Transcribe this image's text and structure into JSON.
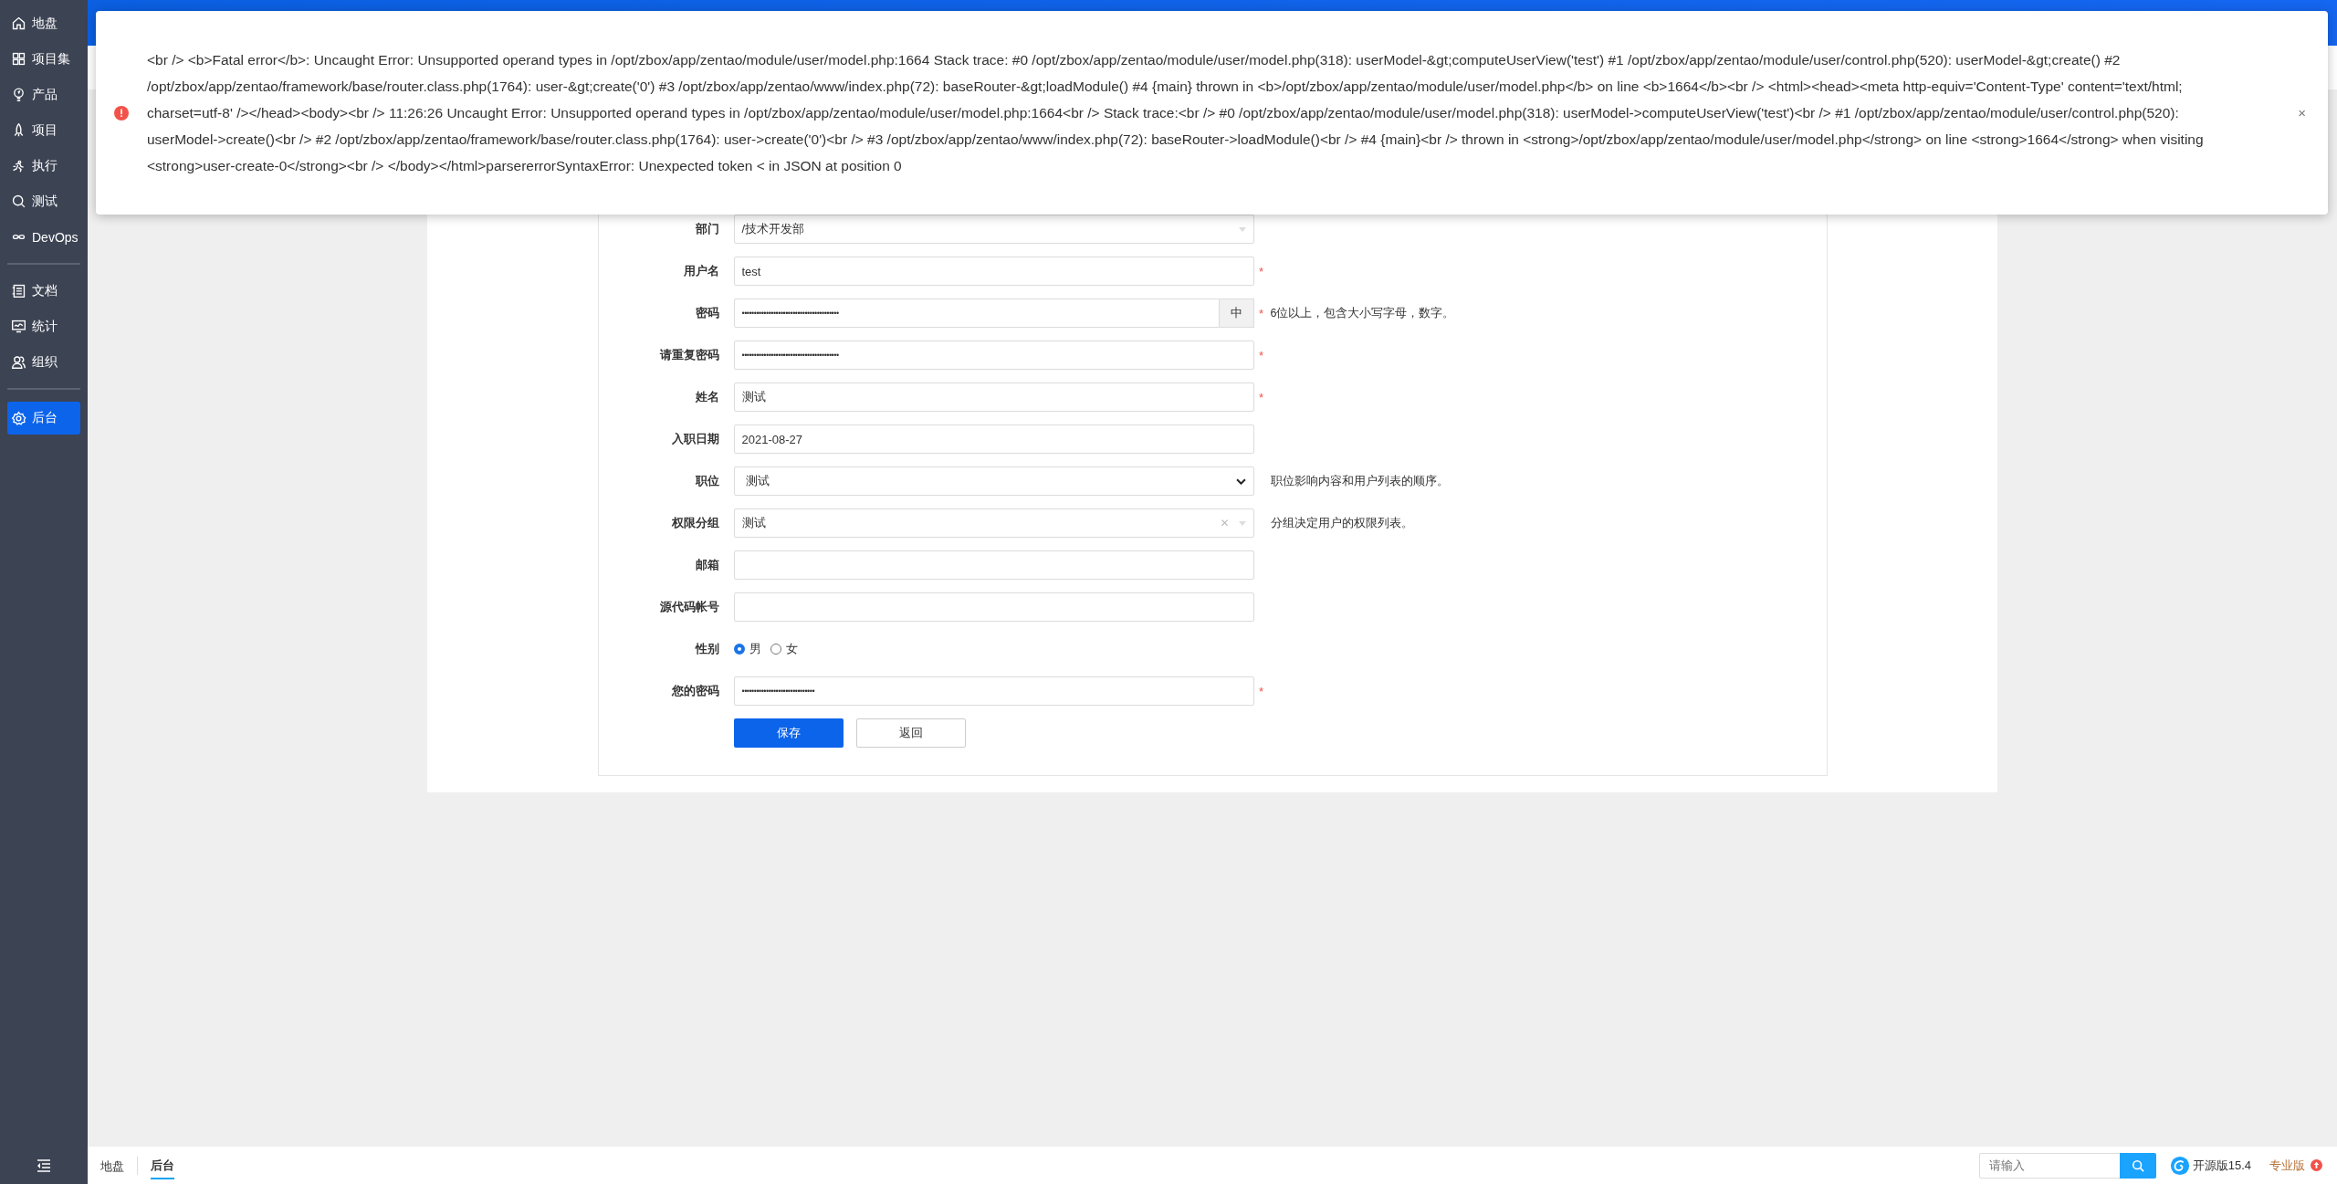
{
  "sidebar": {
    "groups": [
      {
        "items": [
          {
            "label": "地盘",
            "selected": false
          },
          {
            "label": "项目集",
            "selected": false
          },
          {
            "label": "产品",
            "selected": false
          },
          {
            "label": "项目",
            "selected": false
          },
          {
            "label": "执行",
            "selected": false
          },
          {
            "label": "测试",
            "selected": false
          },
          {
            "label": "DevOps",
            "selected": false
          }
        ]
      },
      {
        "items": [
          {
            "label": "文档",
            "selected": false
          },
          {
            "label": "统计",
            "selected": false
          },
          {
            "label": "组织",
            "selected": false
          }
        ]
      },
      {
        "items": [
          {
            "label": "后台",
            "selected": true
          }
        ]
      }
    ]
  },
  "error": {
    "message": "<br /> <b>Fatal error</b>: Uncaught Error: Unsupported operand types in /opt/zbox/app/zentao/module/user/model.php:1664 Stack trace: #0 /opt/zbox/app/zentao/module/user/model.php(318): userModel-&gt;computeUserView('test') #1 /opt/zbox/app/zentao/module/user/control.php(520): userModel-&gt;create() #2 /opt/zbox/app/zentao/framework/base/router.class.php(1764): user-&gt;create('0') #3 /opt/zbox/app/zentao/www/index.php(72): baseRouter-&gt;loadModule() #4 {main} thrown in <b>/opt/zbox/app/zentao/module/user/model.php</b> on line <b>1664</b><br /> <html><head><meta http-equiv='Content-Type' content='text/html; charset=utf-8' /></head><body><br /> 11:26:26 Uncaught Error: Unsupported operand types in /opt/zbox/app/zentao/module/user/model.php:1664<br /> Stack trace:<br /> #0 /opt/zbox/app/zentao/module/user/model.php(318): userModel->computeUserView('test')<br /> #1 /opt/zbox/app/zentao/module/user/control.php(520): userModel->create()<br /> #2 /opt/zbox/app/zentao/framework/base/router.class.php(1764): user->create('0')<br /> #3 /opt/zbox/app/zentao/www/index.php(72): baseRouter->loadModule()<br /> #4 {main}<br /> thrown in <strong>/opt/zbox/app/zentao/module/user/model.php</strong> on line <strong>1664</strong> when visiting <strong>user-create-0</strong><br /> </body></html>parsererrorSyntaxError: Unexpected token < in JSON at position 0",
    "close": "×"
  },
  "form": {
    "fields": [
      {
        "label": "部门",
        "kind": "select",
        "value": "/技术开发部"
      },
      {
        "label": "用户名",
        "kind": "text",
        "value": "test",
        "required_mark": "*"
      },
      {
        "label": "密码",
        "kind": "password",
        "value": "••••••••••••••••••••••••••••••••••••••••",
        "required_mark": "*",
        "addon": "中",
        "hint": "6位以上，包含大小写字母，数字。"
      },
      {
        "label": "请重复密码",
        "kind": "password",
        "value": "••••••••••••••••••••••••••••••••••••••••",
        "required_mark": "*"
      },
      {
        "label": "姓名",
        "kind": "text",
        "value": "测试",
        "required_mark": "*"
      },
      {
        "label": "入职日期",
        "kind": "text",
        "value": "2021-08-27"
      },
      {
        "label": "职位",
        "kind": "dropdown",
        "value": "测试",
        "hint": "职位影响内容和用户列表的顺序。"
      },
      {
        "label": "权限分组",
        "kind": "select",
        "value": "测试",
        "clear": "✕",
        "hint": "分组决定用户的权限列表。"
      },
      {
        "label": "邮箱",
        "kind": "text"
      },
      {
        "label": "源代码帐号",
        "kind": "text"
      },
      {
        "label": "性别",
        "kind": "radio",
        "options": [
          {
            "label": "男",
            "selected": true
          },
          {
            "label": "女",
            "selected": false
          }
        ]
      },
      {
        "label": "您的密码",
        "kind": "password",
        "value": "••••••••••••••••••••••••••••••",
        "required_mark": "*"
      }
    ],
    "buttons": [
      {
        "label": "保存",
        "kind": "primary"
      },
      {
        "label": "返回",
        "kind": "default"
      }
    ]
  },
  "footer": {
    "breadcrumbs": [
      {
        "label": "地盘",
        "selected": false
      },
      {
        "label": "后台",
        "selected": true
      }
    ],
    "search": {
      "placeholder": "请输入"
    },
    "version": "开源版15.4",
    "upgrade": "专业版"
  }
}
